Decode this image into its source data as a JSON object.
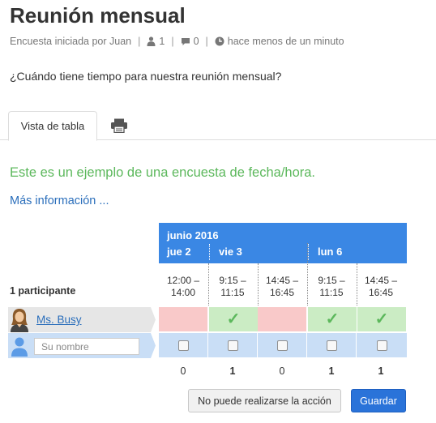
{
  "poll": {
    "title": "Reunión mensual",
    "author_text": "Encuesta iniciada por Juan",
    "participants_count": "1",
    "comments_count": "0",
    "time_ago": "hace menos de un minuto",
    "question": "¿Cuándo tiene tiempo para nuestra reunión mensual?"
  },
  "tabs": {
    "table_view": "Vista de tabla",
    "print_icon": "printer-icon"
  },
  "notice": {
    "example_text": "Este es un ejemplo de una encuesta de fecha/hora.",
    "more_info": "Más información ..."
  },
  "table": {
    "month": "junio 2016",
    "days": [
      "jue 2",
      "vie 3",
      "lun 6"
    ],
    "times": [
      {
        "start": "12:00 –",
        "end": "14:00"
      },
      {
        "start": "9:15 –",
        "end": "11:15"
      },
      {
        "start": "14:45 –",
        "end": "16:45"
      },
      {
        "start": "9:15 –",
        "end": "11:15"
      },
      {
        "start": "14:45 –",
        "end": "16:45"
      }
    ],
    "participants_label": "1 participante",
    "participant": {
      "name": "Ms. Busy",
      "votes": [
        "no",
        "yes",
        "no",
        "yes",
        "yes"
      ]
    },
    "new_row": {
      "placeholder": "Su nombre"
    },
    "counts": [
      "0",
      "1",
      "0",
      "1",
      "1"
    ]
  },
  "buttons": {
    "cannot_attend": "No puede realizarse la acción",
    "save": "Guardar"
  },
  "colors": {
    "header_blue": "#3a87e4",
    "yes_green": "#cbecc4",
    "no_red": "#f9c9c9",
    "input_blue": "#c9def6",
    "link_blue": "#2a6ebb",
    "notice_green": "#5cb85c"
  }
}
